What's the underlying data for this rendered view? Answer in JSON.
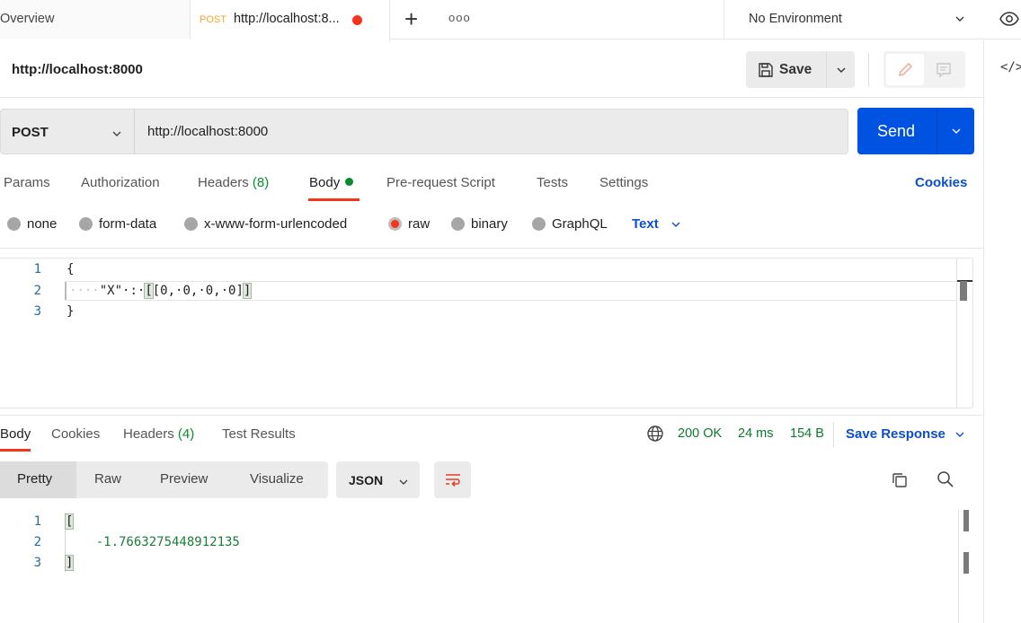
{
  "tabs": {
    "overview_label": "Overview",
    "active_tab": {
      "method": "POST",
      "title": "http://localhost:8...",
      "unsaved": true
    },
    "new_tab_label": "+",
    "more_label": "ooo"
  },
  "environment": {
    "selected": "No Environment"
  },
  "request": {
    "name": "http://localhost:8000",
    "save_label": "Save",
    "method": "POST",
    "url": "http://localhost:8000",
    "send_label": "Send",
    "cookies_label": "Cookies",
    "tabs": [
      {
        "label": "Params"
      },
      {
        "label": "Authorization"
      },
      {
        "label": "Headers",
        "count": "(8)"
      },
      {
        "label": "Body",
        "active": true,
        "has_content": true
      },
      {
        "label": "Pre-request Script"
      },
      {
        "label": "Tests"
      },
      {
        "label": "Settings"
      }
    ],
    "body_types": [
      {
        "label": "none",
        "selected": false
      },
      {
        "label": "form-data",
        "selected": false
      },
      {
        "label": "x-www-form-urlencoded",
        "selected": false
      },
      {
        "label": "raw",
        "selected": true
      },
      {
        "label": "binary",
        "selected": false
      },
      {
        "label": "GraphQL",
        "selected": false
      }
    ],
    "raw_format": "Text",
    "body_lines": [
      {
        "num": "1",
        "text": "{"
      },
      {
        "num": "2",
        "indent": "····",
        "key": "\"X\"",
        "colon": "·:·",
        "open": "[",
        "inner": "[0,·0,·0,·0]",
        "close": "]"
      },
      {
        "num": "3",
        "text": "}"
      }
    ]
  },
  "response": {
    "tabs": [
      {
        "label": "Body",
        "active": true
      },
      {
        "label": "Cookies"
      },
      {
        "label": "Headers",
        "count": "(4)"
      },
      {
        "label": "Test Results"
      }
    ],
    "status": "200 OK",
    "time": "24 ms",
    "size": "154 B",
    "save_label": "Save Response",
    "formats": [
      "Pretty",
      "Raw",
      "Preview",
      "Visualize"
    ],
    "active_format": "Pretty",
    "language": "JSON",
    "lines": [
      {
        "num": "1",
        "text": "["
      },
      {
        "num": "2",
        "text": "    -1.7663275448912135"
      },
      {
        "num": "3",
        "text": "]"
      }
    ]
  },
  "colors": {
    "accent": "#f5341a",
    "send_blue": "#0052e0",
    "link_blue": "#0d4fc8",
    "success_green": "#0b8a2e",
    "method_post": "#f5a623"
  }
}
